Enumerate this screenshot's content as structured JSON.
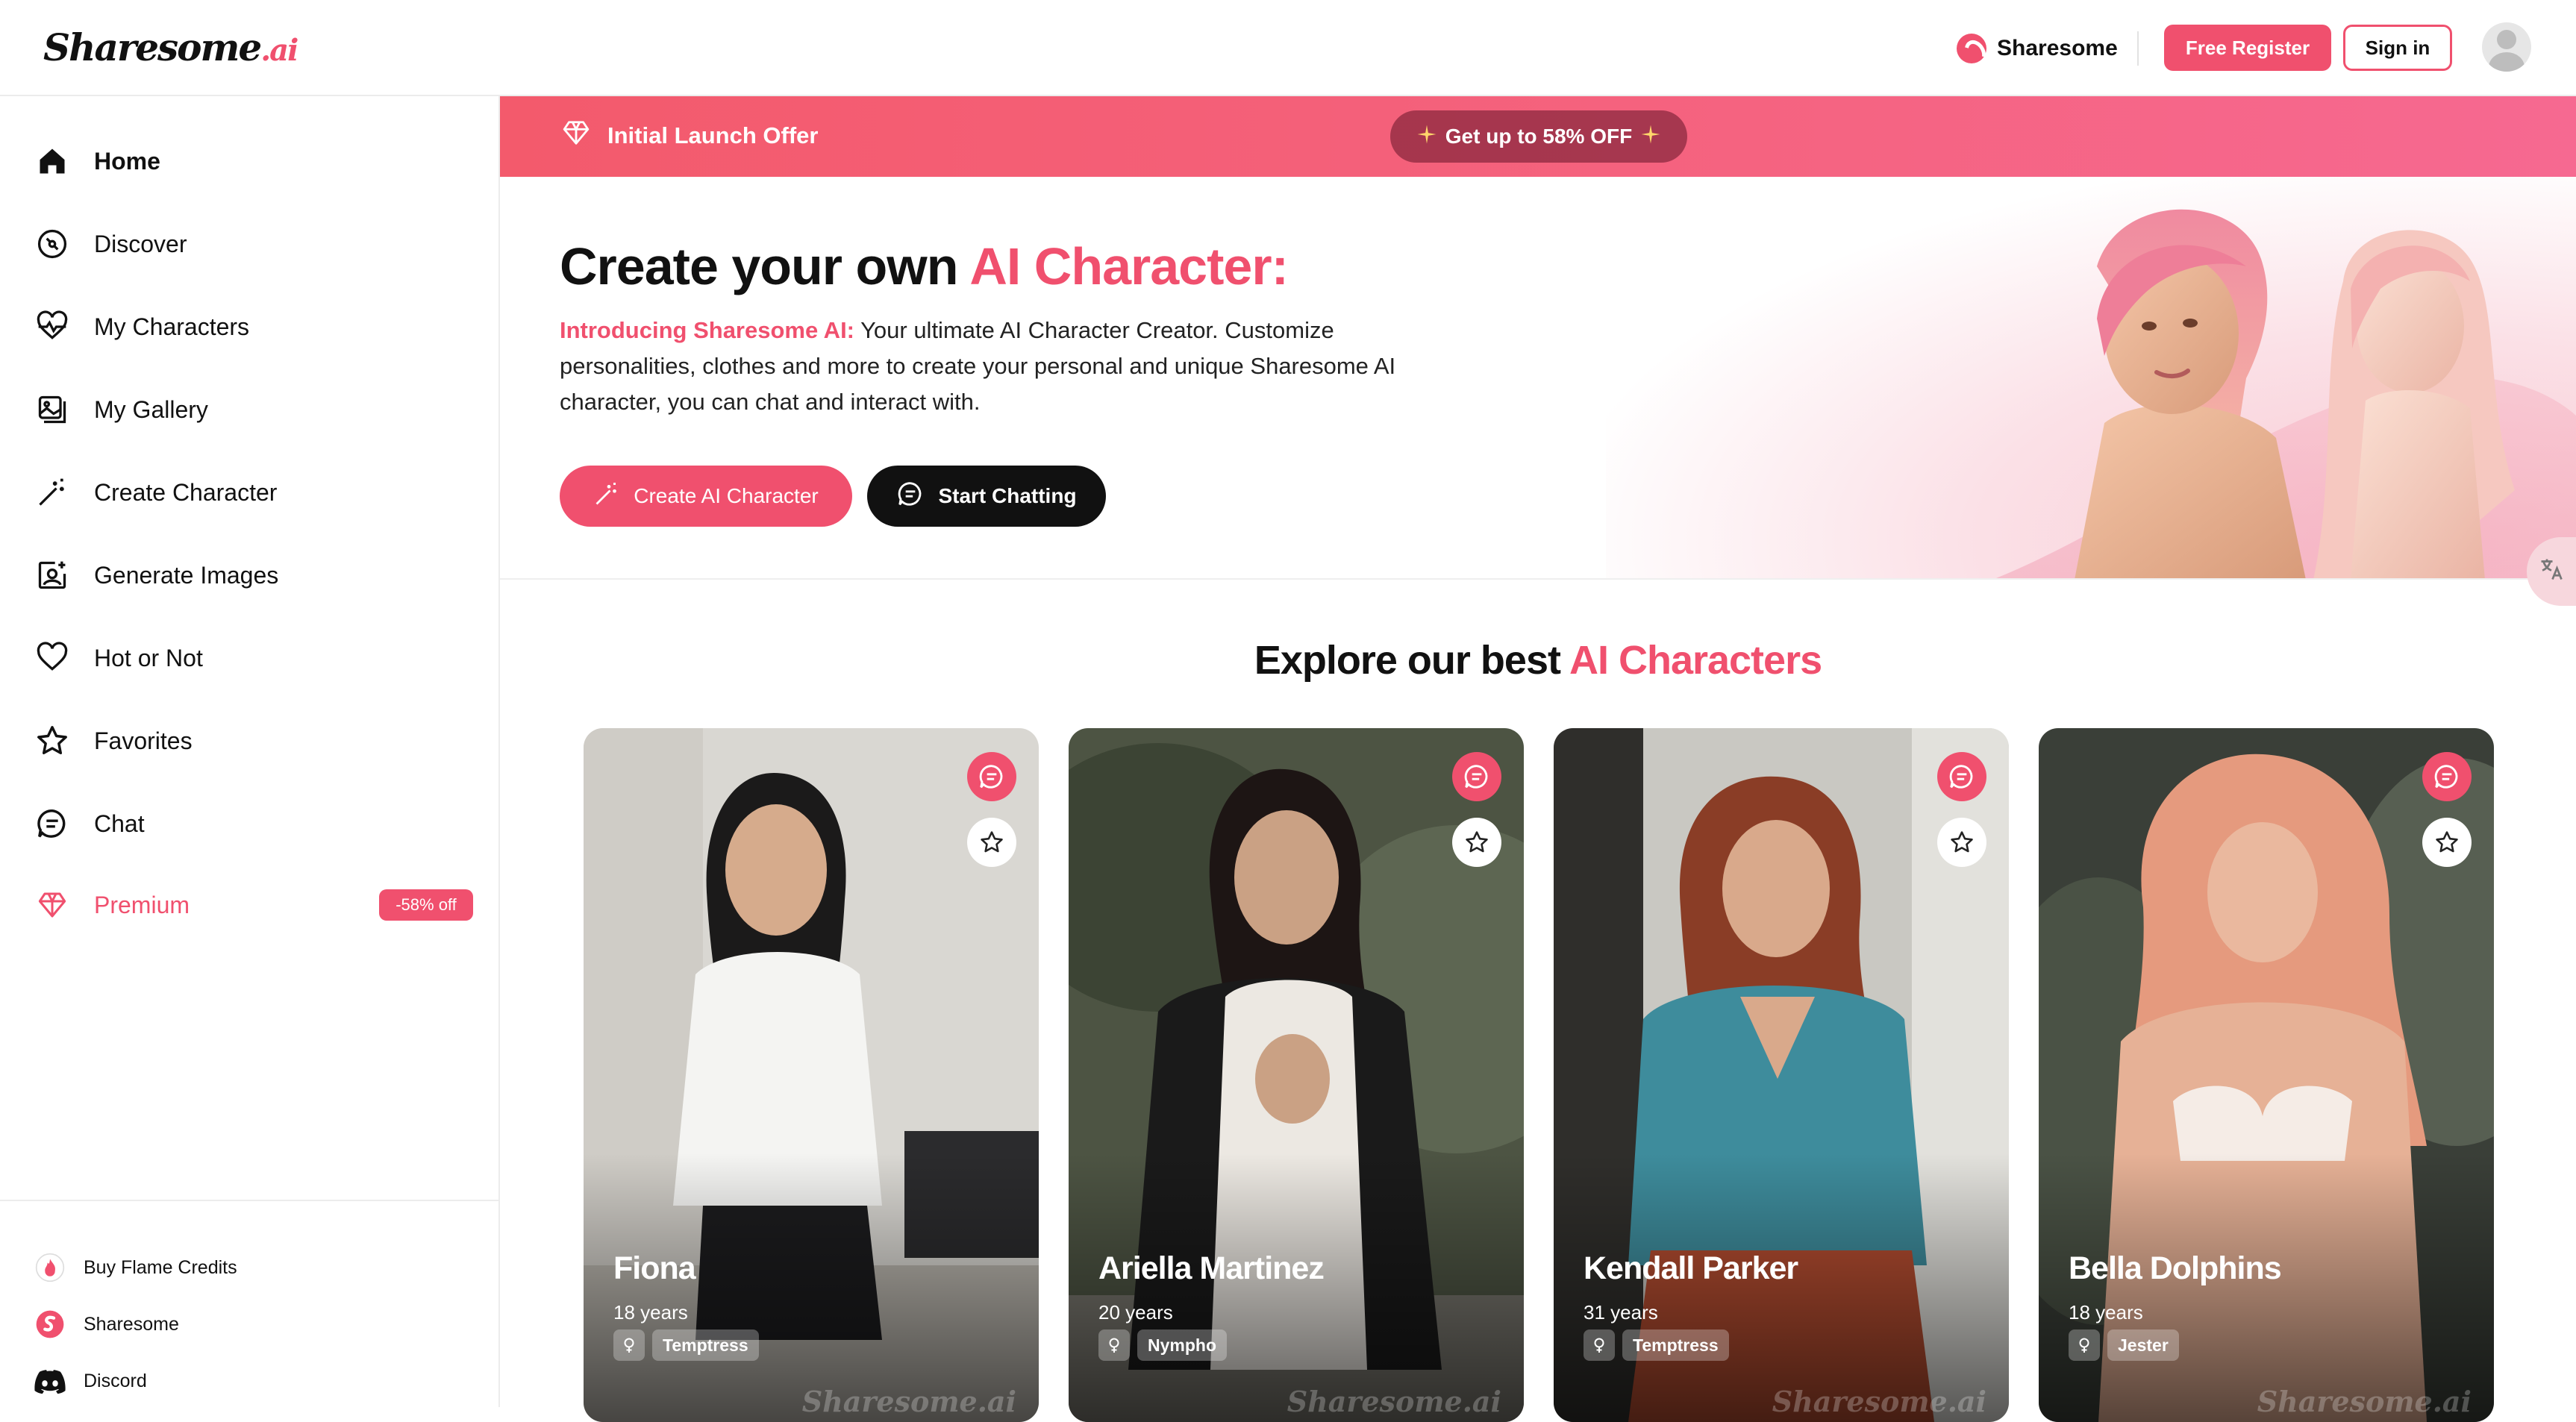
{
  "header": {
    "logo_text": "Sharesome",
    "logo_suffix": ".ai",
    "brand_link": "Sharesome",
    "register_label": "Free Register",
    "signin_label": "Sign in"
  },
  "sidebar": {
    "items": [
      {
        "label": "Home",
        "icon": "home-icon"
      },
      {
        "label": "Discover",
        "icon": "compass-icon"
      },
      {
        "label": "My Characters",
        "icon": "heartbeat-icon"
      },
      {
        "label": "My Gallery",
        "icon": "gallery-icon"
      },
      {
        "label": "Create Character",
        "icon": "magic-wand-icon"
      },
      {
        "label": "Generate Images",
        "icon": "image-sparkle-icon"
      },
      {
        "label": "Hot or Not",
        "icon": "heart-icon"
      },
      {
        "label": "Favorites",
        "icon": "star-icon"
      },
      {
        "label": "Chat",
        "icon": "chat-icon"
      },
      {
        "label": "Premium",
        "icon": "diamond-icon"
      }
    ],
    "premium_badge": "-58% off",
    "footer": [
      {
        "label": "Buy Flame Credits",
        "icon": "flame-icon"
      },
      {
        "label": "Sharesome",
        "icon": "sharesome-icon"
      },
      {
        "label": "Discord",
        "icon": "discord-icon"
      }
    ]
  },
  "banner": {
    "offer_label": "Initial Launch Offer",
    "pill_label": "Get up to 58% OFF"
  },
  "hero": {
    "title_prefix": "Create your own ",
    "title_accent": "AI Character:",
    "lead": "Introducing Sharesome AI:",
    "description": " Your ultimate AI Character Creator. Customize personalities, clothes and more to create your personal and unique Sharesome AI character, you can chat and interact with.",
    "create_button": "Create AI Character",
    "chat_button": "Start Chatting"
  },
  "explore": {
    "title_prefix": "Explore our best ",
    "title_accent": "AI Characters"
  },
  "characters": [
    {
      "name": "Fiona",
      "age": "18 years",
      "tag": "Temptress"
    },
    {
      "name": "Ariella Martinez",
      "age": "20 years",
      "tag": "Nympho"
    },
    {
      "name": "Kendall Parker",
      "age": "31 years",
      "tag": "Temptress"
    },
    {
      "name": "Bella Dolphins",
      "age": "18 years",
      "tag": "Jester"
    }
  ],
  "watermark": "Sharesome.ai",
  "colors": {
    "accent": "#f0506e",
    "dark": "#111111"
  }
}
